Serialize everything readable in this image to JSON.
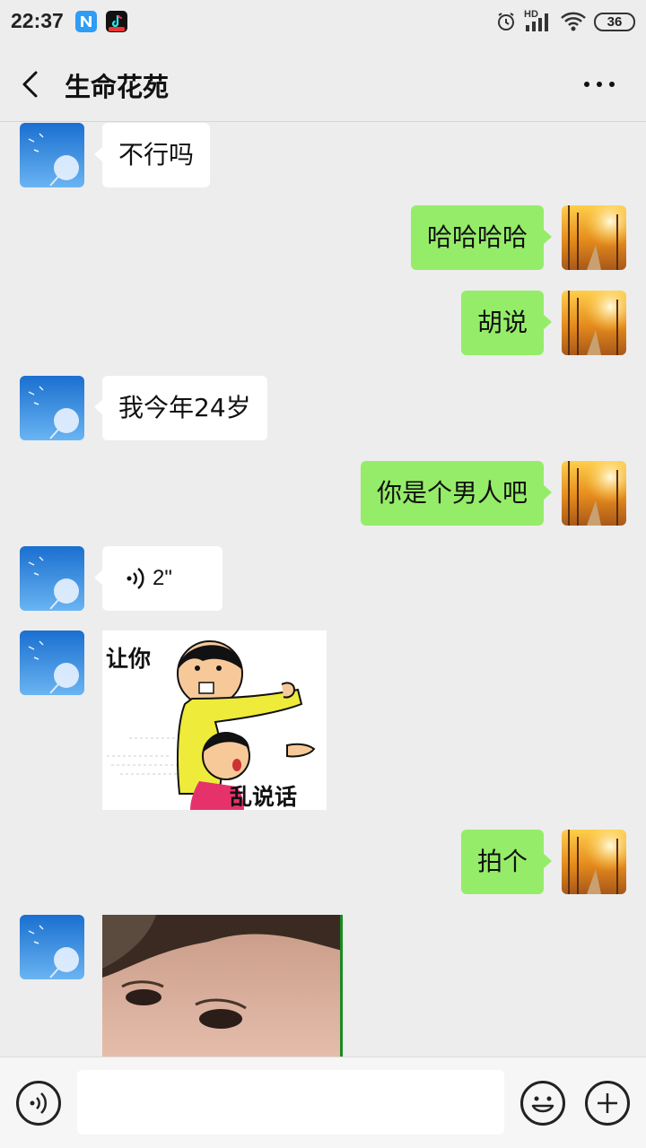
{
  "status": {
    "time": "22:37",
    "network_label": "HD",
    "battery": "36"
  },
  "header": {
    "title": "生命花苑"
  },
  "messages": [
    {
      "side": "in",
      "type": "text",
      "text": "不行吗"
    },
    {
      "side": "out",
      "type": "text",
      "text": "哈哈哈哈"
    },
    {
      "side": "out",
      "type": "text",
      "text": "胡说"
    },
    {
      "side": "in",
      "type": "text",
      "text": "我今年24岁"
    },
    {
      "side": "out",
      "type": "text",
      "text": "你是个男人吧"
    },
    {
      "side": "in",
      "type": "voice",
      "duration": "2\""
    },
    {
      "side": "in",
      "type": "sticker",
      "caption_top": "让你",
      "caption_bottom": "乱说话"
    },
    {
      "side": "out",
      "type": "text",
      "text": "拍个"
    },
    {
      "side": "in",
      "type": "photo"
    }
  ],
  "input": {
    "placeholder": ""
  },
  "colors": {
    "background": "#ededed",
    "bubble_out": "#95ec69",
    "bubble_in": "#ffffff"
  }
}
